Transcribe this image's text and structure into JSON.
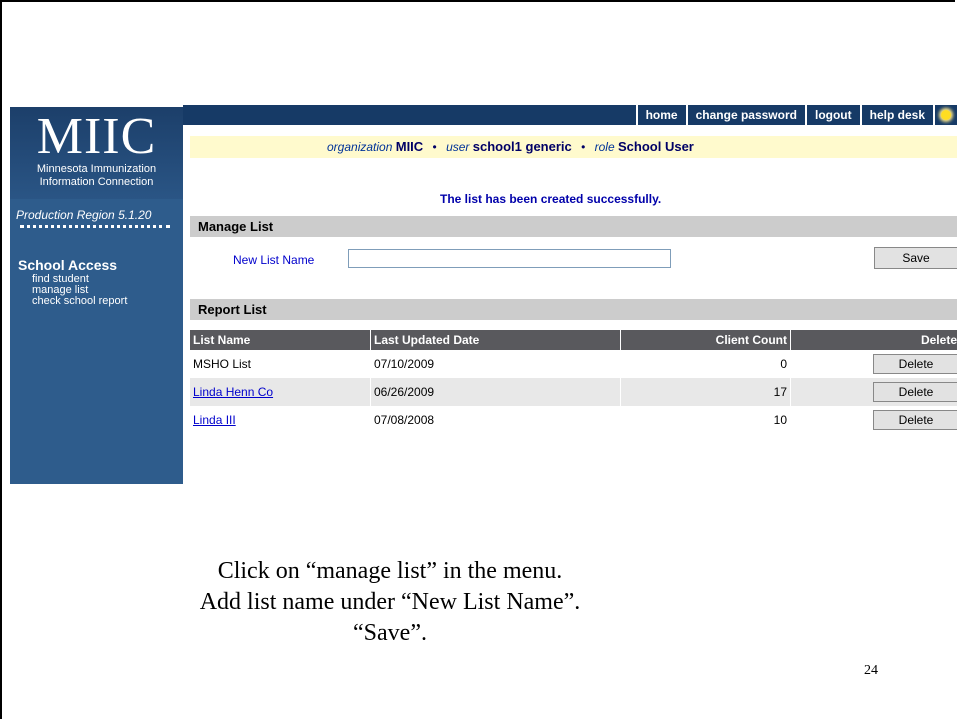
{
  "sidebar": {
    "logo": "MIIC",
    "logo_sub_line1": "Minnesota Immunization",
    "logo_sub_line2": "Information Connection",
    "region": "Production Region 5.1.20",
    "access_title": "School Access",
    "menu": [
      {
        "label": "find student"
      },
      {
        "label": "manage list"
      },
      {
        "label": "check school report"
      }
    ]
  },
  "topnav": {
    "items": [
      {
        "label": "home"
      },
      {
        "label": "change password"
      },
      {
        "label": "logout"
      },
      {
        "label": "help desk"
      }
    ],
    "bulb_icon": "lightbulb-icon"
  },
  "userbar": {
    "org_label": "organization",
    "org_value": "MIIC",
    "user_label": "user",
    "user_value": "school1 generic",
    "role_label": "role",
    "role_value": "School User",
    "separator": "•"
  },
  "message": "The list has been created successfully.",
  "manage_list": {
    "title": "Manage List",
    "new_list_label": "New List Name",
    "new_list_value": "",
    "save_label": "Save"
  },
  "report_list": {
    "title": "Report List",
    "columns": [
      "List Name",
      "Last Updated Date",
      "Client Count",
      "Delete"
    ],
    "rows": [
      {
        "name": "MSHO List",
        "date": "07/10/2009",
        "count": "0",
        "delete": "Delete",
        "link": false
      },
      {
        "name": "Linda Henn Co",
        "date": "06/26/2009",
        "count": "17",
        "delete": "Delete",
        "link": true
      },
      {
        "name": "Linda III",
        "date": "07/08/2008",
        "count": "10",
        "delete": "Delete",
        "link": true
      }
    ]
  },
  "caption": {
    "line1": "Click on “manage list” in the menu.",
    "line2": "Add list name under “New List Name”.",
    "line3": "“Save”."
  },
  "page_number": "24",
  "colors": {
    "sidebar": "#2e5c8c",
    "topbar": "#163a66",
    "userbar": "#fffacd",
    "section_header": "#cccccc",
    "table_header": "#59595d",
    "link": "#0000cc"
  }
}
